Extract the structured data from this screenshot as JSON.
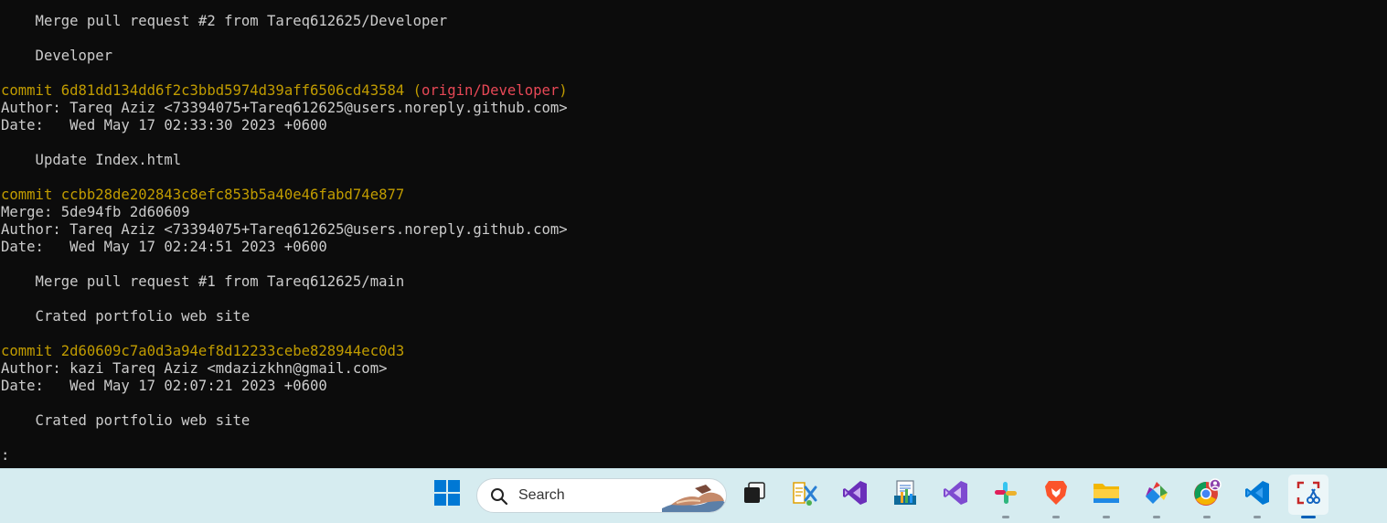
{
  "terminal": {
    "lines": [
      {
        "text": "    Merge pull request #2 from Tareq612625/Developer"
      },
      {
        "text": ""
      },
      {
        "text": "    Developer"
      },
      {
        "text": ""
      },
      {
        "commit_kw": "commit ",
        "hash": "6d81dd134dd6f2c3bbd5974d39aff6506cd43584",
        "ref_open": " (",
        "ref": "origin/Developer",
        "ref_close": ")"
      },
      {
        "text": "Author: Tareq Aziz <73394075+Tareq612625@users.noreply.github.com>"
      },
      {
        "text": "Date:   Wed May 17 02:33:30 2023 +0600"
      },
      {
        "text": ""
      },
      {
        "text": "    Update Index.html"
      },
      {
        "text": ""
      },
      {
        "commit_kw": "commit ",
        "hash": "ccbb28de202843c8efc853b5a40e46fabd74e877"
      },
      {
        "text": "Merge: 5de94fb 2d60609"
      },
      {
        "text": "Author: Tareq Aziz <73394075+Tareq612625@users.noreply.github.com>"
      },
      {
        "text": "Date:   Wed May 17 02:24:51 2023 +0600"
      },
      {
        "text": ""
      },
      {
        "text": "    Merge pull request #1 from Tareq612625/main"
      },
      {
        "text": ""
      },
      {
        "text": "    Crated portfolio web site"
      },
      {
        "text": ""
      },
      {
        "commit_kw": "commit ",
        "hash": "2d60609c7a0d3a94ef8d12233cebe828944ec0d3"
      },
      {
        "text": "Author: kazi Tareq Aziz <mdazizkhn@gmail.com>"
      },
      {
        "text": "Date:   Wed May 17 02:07:21 2023 +0600"
      },
      {
        "text": ""
      },
      {
        "text": "    Crated portfolio web site"
      },
      {
        "text": ""
      },
      {
        "text": ":",
        "is_prompt": true
      }
    ]
  },
  "taskbar": {
    "search": {
      "placeholder": "Search"
    },
    "items": [
      {
        "name": "start",
        "icon": "windows-start-icon",
        "running": false
      },
      {
        "name": "task-view",
        "icon": "task-view-icon",
        "running": false
      },
      {
        "name": "xml-tool",
        "icon": "xml-tool-icon",
        "running": false
      },
      {
        "name": "visual-studio",
        "icon": "visual-studio-icon",
        "running": false
      },
      {
        "name": "report-app",
        "icon": "report-app-icon",
        "running": false
      },
      {
        "name": "visual-studio-2",
        "icon": "visual-studio-icon",
        "running": false
      },
      {
        "name": "slack",
        "icon": "slack-icon",
        "running": true
      },
      {
        "name": "brave",
        "icon": "brave-icon",
        "running": true
      },
      {
        "name": "file-explorer",
        "icon": "folder-icon",
        "running": true
      },
      {
        "name": "git-gui",
        "icon": "git-icon",
        "running": true
      },
      {
        "name": "chrome",
        "icon": "chrome-icon",
        "running": true
      },
      {
        "name": "vscode",
        "icon": "vscode-icon",
        "running": true
      },
      {
        "name": "snipping-tool",
        "icon": "snipping-tool-icon",
        "running": true,
        "active": true
      }
    ]
  },
  "colors": {
    "terminal_bg": "#0c0c0c",
    "terminal_fg": "#cccccc",
    "commit": "#c19c00",
    "ref": "#e74856",
    "taskbar_bg": "#d6ecf0",
    "accent": "#005fb8"
  }
}
